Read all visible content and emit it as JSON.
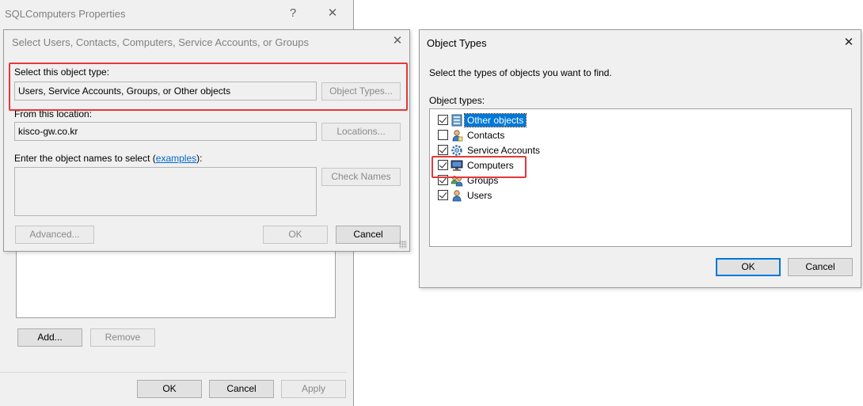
{
  "props_window": {
    "title": "SQLComputers Properties",
    "help_glyph": "?",
    "close_glyph": "✕",
    "buttons": {
      "add": "Add...",
      "remove": "Remove",
      "ok": "OK",
      "cancel": "Cancel",
      "apply": "Apply"
    }
  },
  "select_dialog": {
    "title": "Select Users, Contacts, Computers, Service Accounts, or Groups",
    "close_glyph": "✕",
    "object_type_label": "Select this object type:",
    "object_type_value": "Users, Service Accounts, Groups, or Other objects",
    "object_types_button": "Object Types...",
    "location_label": "From this location:",
    "location_value": "kisco-gw.co.kr",
    "locations_button": "Locations...",
    "names_label_prefix": "Enter the object names to select (",
    "names_label_link": "examples",
    "names_label_suffix": "):",
    "names_value": "",
    "check_names_button": "Check Names",
    "advanced_button": "Advanced...",
    "ok_button": "OK",
    "cancel_button": "Cancel"
  },
  "object_types_dialog": {
    "title": "Object Types",
    "close_glyph": "✕",
    "description": "Select the types of objects you want to find.",
    "list_label": "Object types:",
    "items": [
      {
        "label": "Other objects",
        "checked": true,
        "selected": true,
        "icon": "other-objects-icon"
      },
      {
        "label": "Contacts",
        "checked": false,
        "selected": false,
        "icon": "contact-icon"
      },
      {
        "label": "Service Accounts",
        "checked": true,
        "selected": false,
        "icon": "service-account-icon"
      },
      {
        "label": "Computers",
        "checked": true,
        "selected": false,
        "icon": "computer-icon"
      },
      {
        "label": "Groups",
        "checked": true,
        "selected": false,
        "icon": "group-icon"
      },
      {
        "label": "Users",
        "checked": true,
        "selected": false,
        "icon": "user-icon"
      }
    ],
    "ok_button": "OK",
    "cancel_button": "Cancel"
  },
  "colors": {
    "highlight_box": "#e2383c",
    "selection": "#0078d7",
    "link": "#0066cc"
  }
}
